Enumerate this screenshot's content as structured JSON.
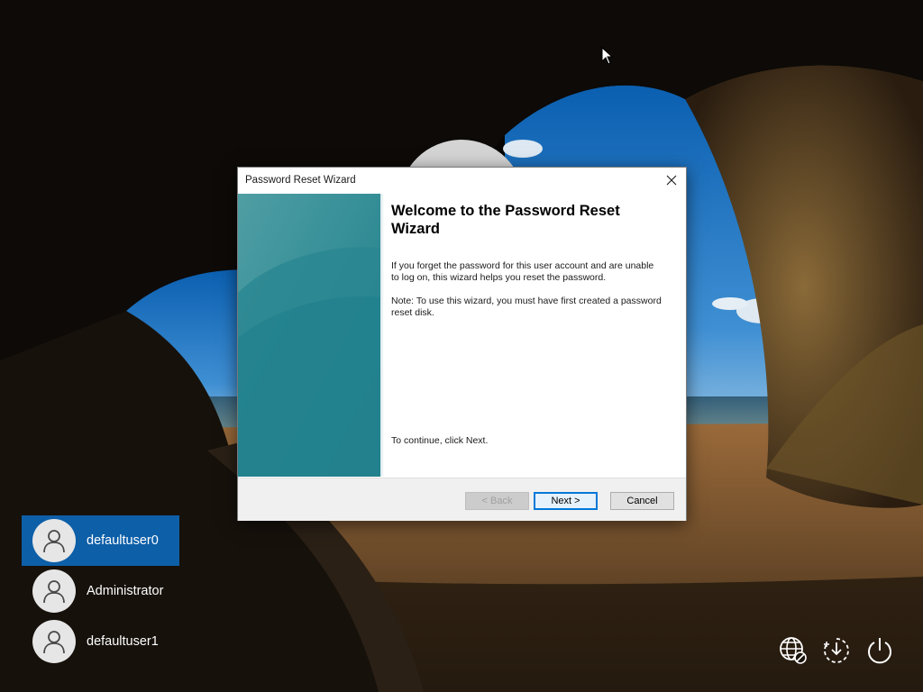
{
  "dialog": {
    "title": "Password Reset Wizard",
    "heading": "Welcome to the Password Reset Wizard",
    "paragraph1": "If you forget the password for this user account and are unable to log on, this wizard helps you reset the password.",
    "paragraph2": "Note: To use this wizard, you must have first created a password reset disk.",
    "continue_text": "To continue, click Next.",
    "buttons": {
      "back": "< Back",
      "next": "Next >",
      "cancel": "Cancel"
    }
  },
  "users": [
    {
      "name": "defaultuser0",
      "selected": true
    },
    {
      "name": "Administrator",
      "selected": false
    },
    {
      "name": "defaultuser1",
      "selected": false
    }
  ],
  "system_icons": [
    "network-icon",
    "accessibility-icon",
    "power-icon"
  ],
  "colors": {
    "accent": "#0078d7",
    "selected_user": "#0d5fa8",
    "side_panel": "#3a8f94"
  }
}
